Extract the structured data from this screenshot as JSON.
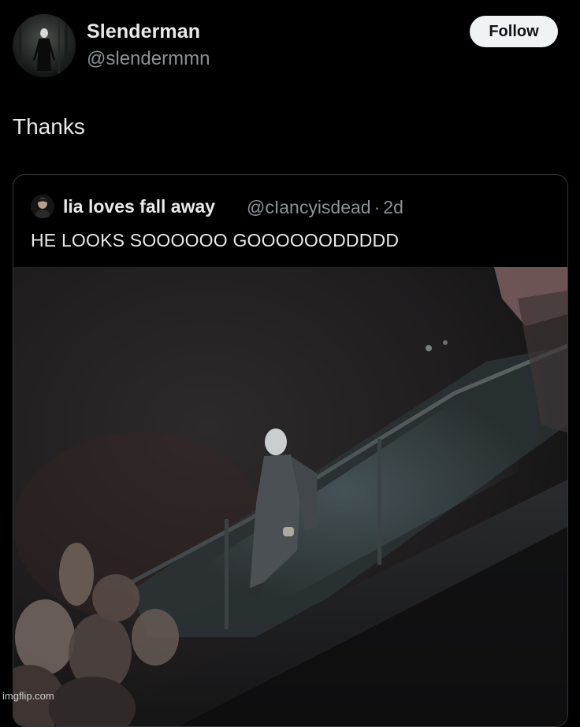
{
  "post": {
    "author": {
      "display_name": "Slenderman",
      "handle": "@slendermmn",
      "avatar_icon": "avatar-image"
    },
    "follow_label": "Follow",
    "text": "Thanks"
  },
  "quoted_post": {
    "author": {
      "display_name": "lia loves fall away",
      "handle": "@cIancyisdead",
      "separator": "·",
      "time": "2d",
      "avatar_icon": "avatar-image"
    },
    "text": "HE LOOKS SOOOOOO GOOOOOODDDDD",
    "media": {
      "type": "video-still",
      "icon": "concert-photo"
    }
  },
  "watermark": "imgflip.com",
  "colors": {
    "background": "#000000",
    "primary_text": "#e7e9ea",
    "secondary_text": "#8b9198",
    "follow_button_bg": "#eff3f4",
    "card_border": "#333639"
  }
}
